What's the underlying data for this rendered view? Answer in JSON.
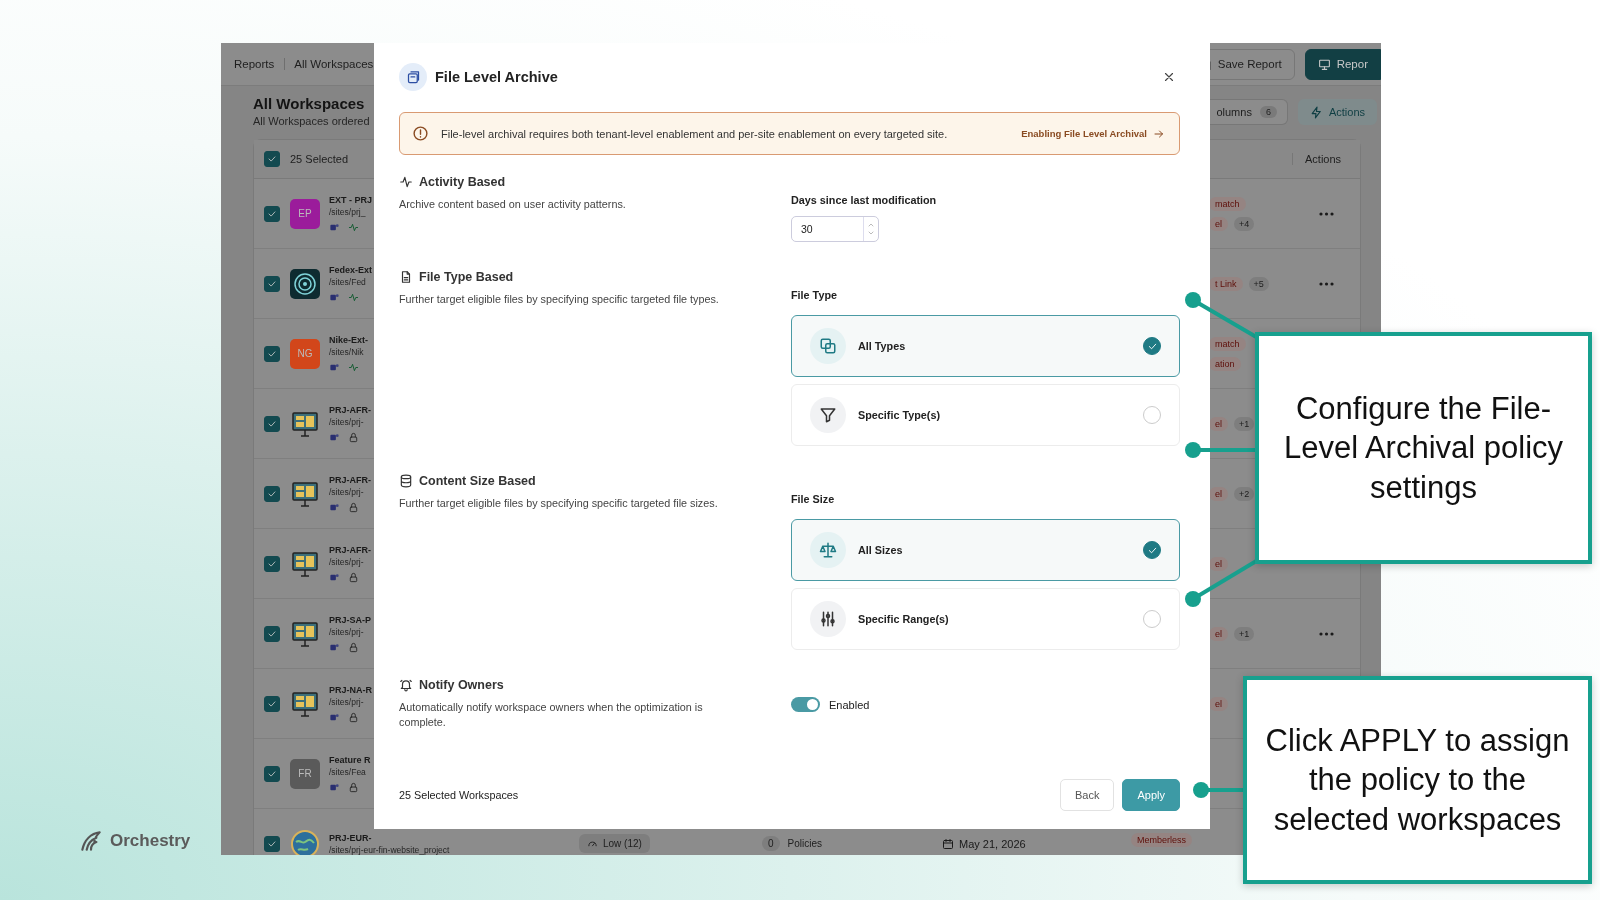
{
  "app": {
    "breadcrumbs": [
      {
        "label": "Reports"
      },
      {
        "label": "All Workspaces"
      }
    ],
    "buttons": [
      {
        "label": "Save Report",
        "kind": "outline"
      },
      {
        "label": "Repor",
        "kind": "primary"
      }
    ],
    "title": "All Workspaces",
    "subtitle": "All Workspaces ordered",
    "select_all": {
      "label": "25 Selected",
      "checked": true
    },
    "columns": {
      "label": "olumns",
      "count": "6"
    },
    "actions_button": "Actions",
    "actions_header": "Actions",
    "rows": [
      {
        "name": "EXT - PRJ",
        "path": "/sites/prj_",
        "avatar": {
          "kind": "initials",
          "text": "EP",
          "color": "#9b1c9b"
        },
        "checked": true,
        "kind": "activity",
        "tags": [
          "match",
          "el"
        ],
        "more": "+4",
        "menu": true
      },
      {
        "name": "Fedex-Ext",
        "path": "/sites/Fed",
        "avatar": {
          "kind": "radar"
        },
        "checked": true,
        "kind": "activity",
        "tags": [
          "t Link"
        ],
        "more": "+5",
        "menu": true
      },
      {
        "name": "Nike-Ext-",
        "path": "/sites/Nik",
        "avatar": {
          "kind": "initials",
          "text": "NG",
          "color": "#d2461a"
        },
        "checked": true,
        "kind": "activity",
        "tags": [
          "match",
          "ation"
        ],
        "menu": false
      },
      {
        "name": "PRJ-AFR-",
        "path": "/sites/prj-",
        "avatar": {
          "kind": "board"
        },
        "checked": true,
        "kind": "lock",
        "tags": [
          "el"
        ],
        "more": "+1",
        "menu": false
      },
      {
        "name": "PRJ-AFR-",
        "path": "/sites/prj-",
        "avatar": {
          "kind": "board"
        },
        "checked": true,
        "kind": "lock",
        "tags": [
          "el"
        ],
        "more": "+2",
        "menu": false
      },
      {
        "name": "PRJ-AFR-",
        "path": "/sites/prj-",
        "avatar": {
          "kind": "board"
        },
        "checked": true,
        "kind": "lock",
        "tags": [
          "el"
        ],
        "menu": false
      },
      {
        "name": "PRJ-SA-P",
        "path": "/sites/prj-",
        "avatar": {
          "kind": "board"
        },
        "checked": true,
        "kind": "lock",
        "tags": [
          "el"
        ],
        "more": "+1",
        "menu": true
      },
      {
        "name": "PRJ-NA-R",
        "path": "/sites/prj-",
        "avatar": {
          "kind": "board"
        },
        "checked": true,
        "kind": "lock",
        "tags": [
          "el"
        ],
        "menu": false
      },
      {
        "name": "Feature R",
        "path": "/sites/Fea",
        "avatar": {
          "kind": "initials",
          "text": "FR",
          "color": "#5a5a5a"
        },
        "checked": true,
        "kind": "lock",
        "tags": [],
        "menu": false
      },
      {
        "name": "PRJ-EUR-",
        "path": "/sites/prj-eur-fin-website_project",
        "avatar": {
          "kind": "globe"
        },
        "checked": true,
        "tags": [],
        "menu": false,
        "details": {
          "risk": "Low (12)",
          "count": "0",
          "count_label": "Policies",
          "date": "May 21, 2026",
          "tag": "Memberless"
        }
      }
    ]
  },
  "modal": {
    "title": "File Level Archive",
    "alert": {
      "text": "File-level archival requires both tenant-level enablement and per-site enablement on every targeted site.",
      "link": "Enabling File Level Archival"
    },
    "sections": [
      {
        "kind": "number",
        "title": "Activity Based",
        "description": "Archive content based on user activity patterns.",
        "label": "Days since last modification",
        "value": "30"
      },
      {
        "kind": "options",
        "title": "File Type Based",
        "description": "Further target eligible files by specifying specific targeted file types.",
        "label": "File Type",
        "options": [
          {
            "label": "All Types",
            "selected": true
          },
          {
            "label": "Specific Type(s)",
            "selected": false
          }
        ]
      },
      {
        "kind": "options",
        "title": "Content Size Based",
        "description": "Further target eligible files by specifying specific targeted file sizes.",
        "label": "File Size",
        "options": [
          {
            "label": "All Sizes",
            "selected": true
          },
          {
            "label": "Specific Range(s)",
            "selected": false
          }
        ]
      },
      {
        "kind": "toggle",
        "title": "Notify Owners",
        "description": "Automatically notify workspace owners when the optimization is complete.",
        "label": "Enabled",
        "on": true
      }
    ],
    "footer": "25 Selected Workspaces",
    "buttons": [
      {
        "label": "Back",
        "kind": "secondary"
      },
      {
        "label": "Apply",
        "kind": "primary"
      }
    ]
  },
  "callouts": [
    {
      "text": "Configure the File-Level Archival policy settings"
    },
    {
      "text": "Click APPLY to assign the policy to the selected workspaces"
    }
  ],
  "brand": "Orchestry"
}
